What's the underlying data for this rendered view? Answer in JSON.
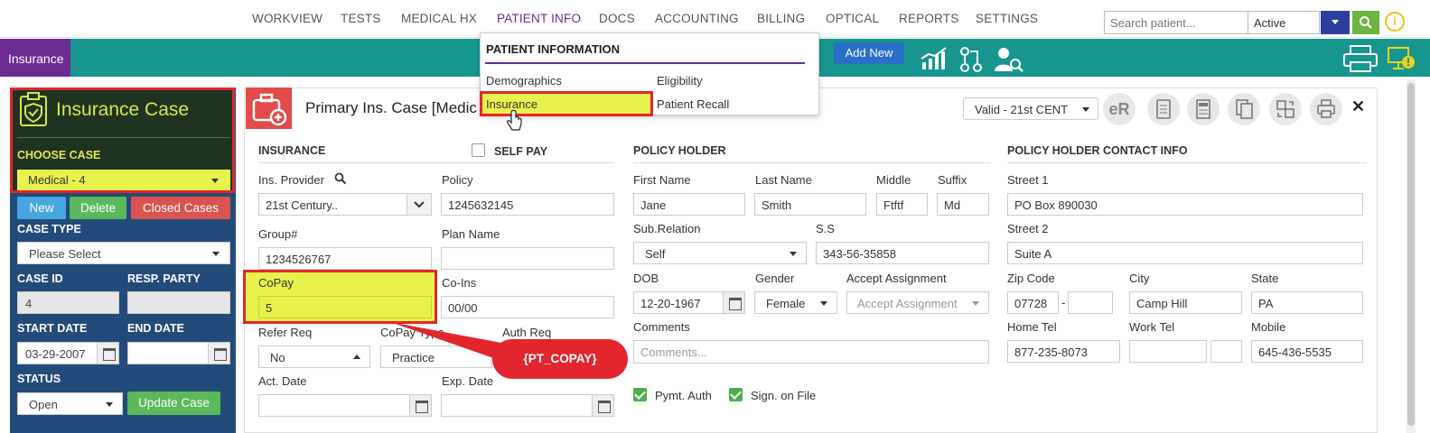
{
  "topnav": {
    "items": [
      "WORKVIEW",
      "TESTS",
      "MEDICAL HX",
      "PATIENT INFO",
      "DOCS",
      "ACCOUNTING",
      "BILLING",
      "OPTICAL",
      "REPORTS",
      "SETTINGS"
    ],
    "search_placeholder": "Search patient...",
    "status_value": "Active"
  },
  "toolbar": {
    "tab_label": "Insurance",
    "add_new_label": "Add New"
  },
  "menu": {
    "heading": "PATIENT INFORMATION",
    "items": [
      "Demographics",
      "Insurance",
      "Eligibility",
      "Patient Recall"
    ]
  },
  "sidebar": {
    "title": "Insurance Case",
    "choose_case_label": "CHOOSE CASE",
    "choose_case_value": "Medical - 4",
    "new_label": "New",
    "delete_label": "Delete",
    "closed_cases_label": "Closed Cases",
    "case_type_label": "CASE TYPE",
    "case_type_value": "Please Select",
    "case_id_label": "CASE ID",
    "case_id_value": "4",
    "resp_party_label": "RESP. PARTY",
    "resp_party_value": "",
    "start_date_label": "START DATE",
    "start_date_value": "03-29-2007",
    "end_date_label": "END DATE",
    "end_date_value": "",
    "status_label": "STATUS",
    "status_value": "Open",
    "update_case_label": "Update Case"
  },
  "main": {
    "title": "Primary Ins. Case [Medic",
    "valid_select": "Valid - 21st CENT",
    "er_label": "eR",
    "close_label": "✕"
  },
  "insurance": {
    "section": "INSURANCE",
    "self_pay_label": "SELF PAY",
    "provider_label": "Ins. Provider",
    "provider_value": "21st Century..",
    "policy_label": "Policy",
    "policy_value": "1245632145",
    "group_label": "Group#",
    "group_value": "1234526767",
    "plan_name_label": "Plan Name",
    "plan_name_value": "",
    "copay_label": "CoPay",
    "copay_value": "5",
    "coins_label": "Co-Ins",
    "coins_value": "00/00",
    "refer_req_label": "Refer Req",
    "refer_req_value": "No",
    "copay_type_label": "CoPay Type",
    "copay_type_value": "Practice",
    "auth_req_label": "Auth Req",
    "act_date_label": "Act. Date",
    "exp_date_label": "Exp. Date"
  },
  "policy_holder": {
    "section": "POLICY HOLDER",
    "first_name_label": "First Name",
    "first_name_value": "Jane",
    "last_name_label": "Last Name",
    "last_name_value": "Smith",
    "middle_label": "Middle",
    "middle_value": "Ftftf",
    "suffix_label": "Suffix",
    "suffix_value": "Md",
    "sub_relation_label": "Sub.Relation",
    "sub_relation_value": "Self",
    "ss_label": "S.S",
    "ss_value": "343-56-35858",
    "dob_label": "DOB",
    "dob_value": "12-20-1967",
    "gender_label": "Gender",
    "gender_value": "Female",
    "accept_label": "Accept Assignment",
    "accept_placeholder": "Accept Assignment",
    "comments_label": "Comments",
    "comments_placeholder": "Comments...",
    "pymt_auth_label": "Pymt. Auth",
    "sign_label": "Sign. on File"
  },
  "contact": {
    "section": "POLICY HOLDER CONTACT INFO",
    "street1_label": "Street 1",
    "street1_value": "PO Box 890030",
    "street2_label": "Street 2",
    "street2_value": "Suite A",
    "zip_label": "Zip Code",
    "zip_value": "07728",
    "zip_sep": "-",
    "city_label": "City",
    "city_value": "Camp Hill",
    "state_label": "State",
    "state_value": "PA",
    "home_tel_label": "Home Tel",
    "home_tel_value": "877-235-8073",
    "work_tel_label": "Work Tel",
    "mobile_label": "Mobile",
    "mobile_value": "645-436-5535"
  },
  "annotation": {
    "label": "{PT_COPAY}"
  },
  "colors": {
    "accent_purple": "#6a2c91",
    "teal_bar": "#17958f",
    "sidebar_blue": "#234b7a",
    "highlight_yellow": "#e9f24c",
    "highlight_red": "#e3262d"
  }
}
